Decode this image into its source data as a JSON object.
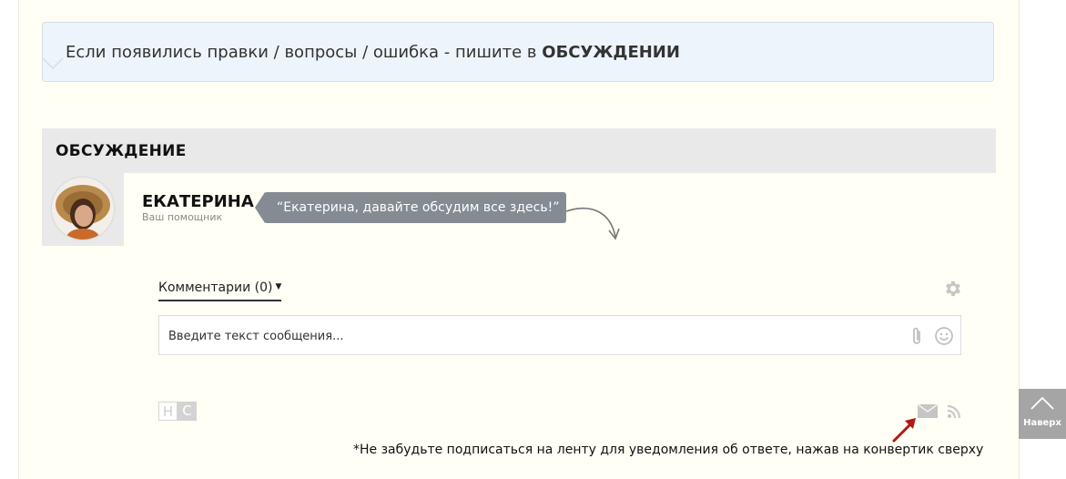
{
  "notice": {
    "text": "Если появились правки / вопросы / ошибка - пишите в ",
    "emphasis": "ОБСУЖДЕНИИ"
  },
  "discussion": {
    "title": "ОБСУЖДЕНИЕ",
    "helper": {
      "name": "ЕКАТЕРИНА",
      "role": "Ваш помощник",
      "bubble": "“Екатерина, давайте обсудим все здесь!”"
    }
  },
  "comments": {
    "tab_label": "Комментарии (0)",
    "input_placeholder": "Введите текст сообщения...",
    "icons": {
      "settings": "gear-icon",
      "attach": "paperclip-icon",
      "emoji": "smile-icon",
      "subscribe": "envelope-icon",
      "rss": "rss-icon"
    },
    "logo": {
      "h": "Н",
      "c": "С"
    }
  },
  "footnote": "*Не забудьте подписаться на ленту для уведомления об ответе, нажав на конвертик сверху",
  "scroll_top": {
    "label": "Наверх"
  },
  "colors": {
    "page_bg": "#fffff5",
    "notice_bg": "#eef4fb",
    "header_bg": "#e9e9e9",
    "bubble_bg": "#858b93",
    "arrow_red": "#b01818",
    "top_button_bg": "#a5a5a5"
  }
}
